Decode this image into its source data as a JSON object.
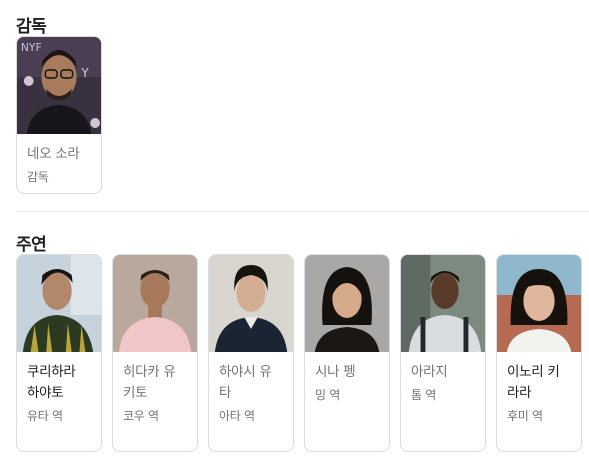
{
  "director_section": {
    "title": "감독",
    "people": [
      {
        "name": "네오 소라",
        "role": "감독"
      }
    ]
  },
  "cast_section": {
    "title": "주연",
    "people": [
      {
        "name": "쿠리하라 하야토",
        "role": "유타 역"
      },
      {
        "name": "히다카 유키토",
        "role": "코우 역"
      },
      {
        "name": "하야시 유타",
        "role": "아타 역"
      },
      {
        "name": "시나 펭",
        "role": "밍 역"
      },
      {
        "name": "아라지",
        "role": "톰 역"
      },
      {
        "name": "이노리 키라라",
        "role": "후미 역"
      }
    ]
  }
}
